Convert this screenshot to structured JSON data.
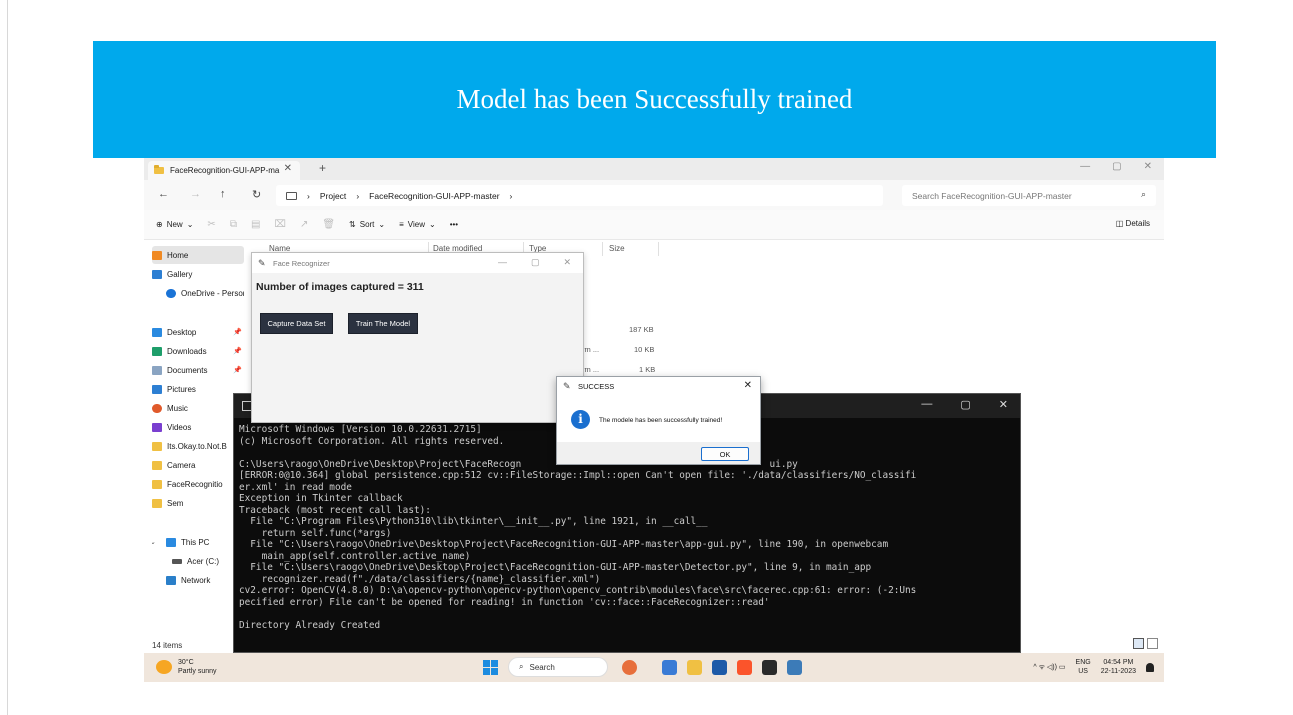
{
  "banner": {
    "title": "Model has been Successfully trained"
  },
  "explorer": {
    "tab_title": "FaceRecognition-GUI-APP-ma",
    "tab_close": "✕",
    "new_tab": "+",
    "window_controls": [
      "—",
      "▢",
      "✕"
    ],
    "nav": {
      "back": "←",
      "forward": "→",
      "up": "↑",
      "refresh": "↻"
    },
    "breadcrumb": [
      "Project",
      "FaceRecognition-GUI-APP-master"
    ],
    "search_placeholder": "Search FaceRecognition-GUI-APP-master",
    "toolbar": {
      "new": "New",
      "sort": "Sort",
      "view": "View",
      "more": "•••",
      "details": "Details"
    },
    "sidebar": [
      {
        "label": "Home",
        "icon": "home-icon"
      },
      {
        "label": "Gallery",
        "icon": "gallery-icon"
      },
      {
        "label": "OneDrive - Persona",
        "icon": "cloud-icon"
      },
      {
        "label": "Desktop",
        "icon": "desktop-icon"
      },
      {
        "label": "Downloads",
        "icon": "download-icon"
      },
      {
        "label": "Documents",
        "icon": "document-icon"
      },
      {
        "label": "Pictures",
        "icon": "pictures-icon"
      },
      {
        "label": "Music",
        "icon": "music-icon"
      },
      {
        "label": "Videos",
        "icon": "videos-icon"
      },
      {
        "label": "Its.Okay.to.Not.B",
        "icon": "folder-icon"
      },
      {
        "label": "Camera",
        "icon": "folder-icon"
      },
      {
        "label": "FaceRecognitio",
        "icon": "folder-icon"
      },
      {
        "label": "Sem",
        "icon": "folder-icon"
      },
      {
        "label": "This PC",
        "icon": "pc-icon"
      },
      {
        "label": "Acer (C:)",
        "icon": "drive-icon"
      },
      {
        "label": "Network",
        "icon": "network-icon"
      }
    ],
    "columns": [
      "Name",
      "Date modified",
      "Type",
      "Size"
    ],
    "visible_cells": {
      "size_1": "187 KB",
      "type_2": "rm ...",
      "size_2": "10 KB",
      "type_3": "rm ...",
      "size_3": "1 KB"
    },
    "status": "14 items"
  },
  "tk_window": {
    "title": "Face Recognizer",
    "controls": [
      "—",
      "▢",
      "✕"
    ],
    "count_text": "Number of images captured = 311",
    "buttons": [
      "Capture Data Set",
      "Train The Model"
    ]
  },
  "cmd": {
    "controls": [
      "—",
      "▢",
      "✕"
    ],
    "lines": [
      "Microsoft Windows [Version 10.0.22631.2715]",
      "(c) Microsoft Corporation. All rights reserved.",
      "",
      "C:\\Users\\raogo\\OneDrive\\Desktop\\Project\\FaceRecogn                                            ui.py",
      "[ERROR:0@10.364] global persistence.cpp:512 cv::FileStorage::Impl::open Can't open file: './data/classifiers/NO_classifi",
      "er.xml' in read mode",
      "Exception in Tkinter callback",
      "Traceback (most recent call last):",
      "  File \"C:\\Program Files\\Python310\\lib\\tkinter\\__init__.py\", line 1921, in __call__",
      "    return self.func(*args)",
      "  File \"C:\\Users\\raogo\\OneDrive\\Desktop\\Project\\FaceRecognition-GUI-APP-master\\app-gui.py\", line 190, in openwebcam",
      "    main_app(self.controller.active_name)",
      "  File \"C:\\Users\\raogo\\OneDrive\\Desktop\\Project\\FaceRecognition-GUI-APP-master\\Detector.py\", line 9, in main_app",
      "    recognizer.read(f\"./data/classifiers/{name}_classifier.xml\")",
      "cv2.error: OpenCV(4.8.0) D:\\a\\opencv-python\\opencv-python\\opencv_contrib\\modules\\face\\src\\facerec.cpp:61: error: (-2:Uns",
      "pecified error) File can't be opened for reading! in function 'cv::face::FaceRecognizer::read'",
      "",
      "Directory Already Created"
    ]
  },
  "dialog": {
    "title": "SUCCESS",
    "close": "✕",
    "icon": "info-icon",
    "message": "The modele has been successfully trained!",
    "ok": "OK"
  },
  "taskbar": {
    "temperature": "30°C",
    "weather": "Partly sunny",
    "search": "Search",
    "lang_top": "ENG",
    "lang_bottom": "US",
    "time": "04:54 PM",
    "date": "22-11-2023",
    "tray_symbols": "^ ᯤ ◁)) ▭"
  },
  "colors": {
    "banner": "#00a9ec",
    "taskbar": "#f0e6dc",
    "cmd_bg": "#0c0c0c",
    "accent": "#1a6fcf"
  }
}
